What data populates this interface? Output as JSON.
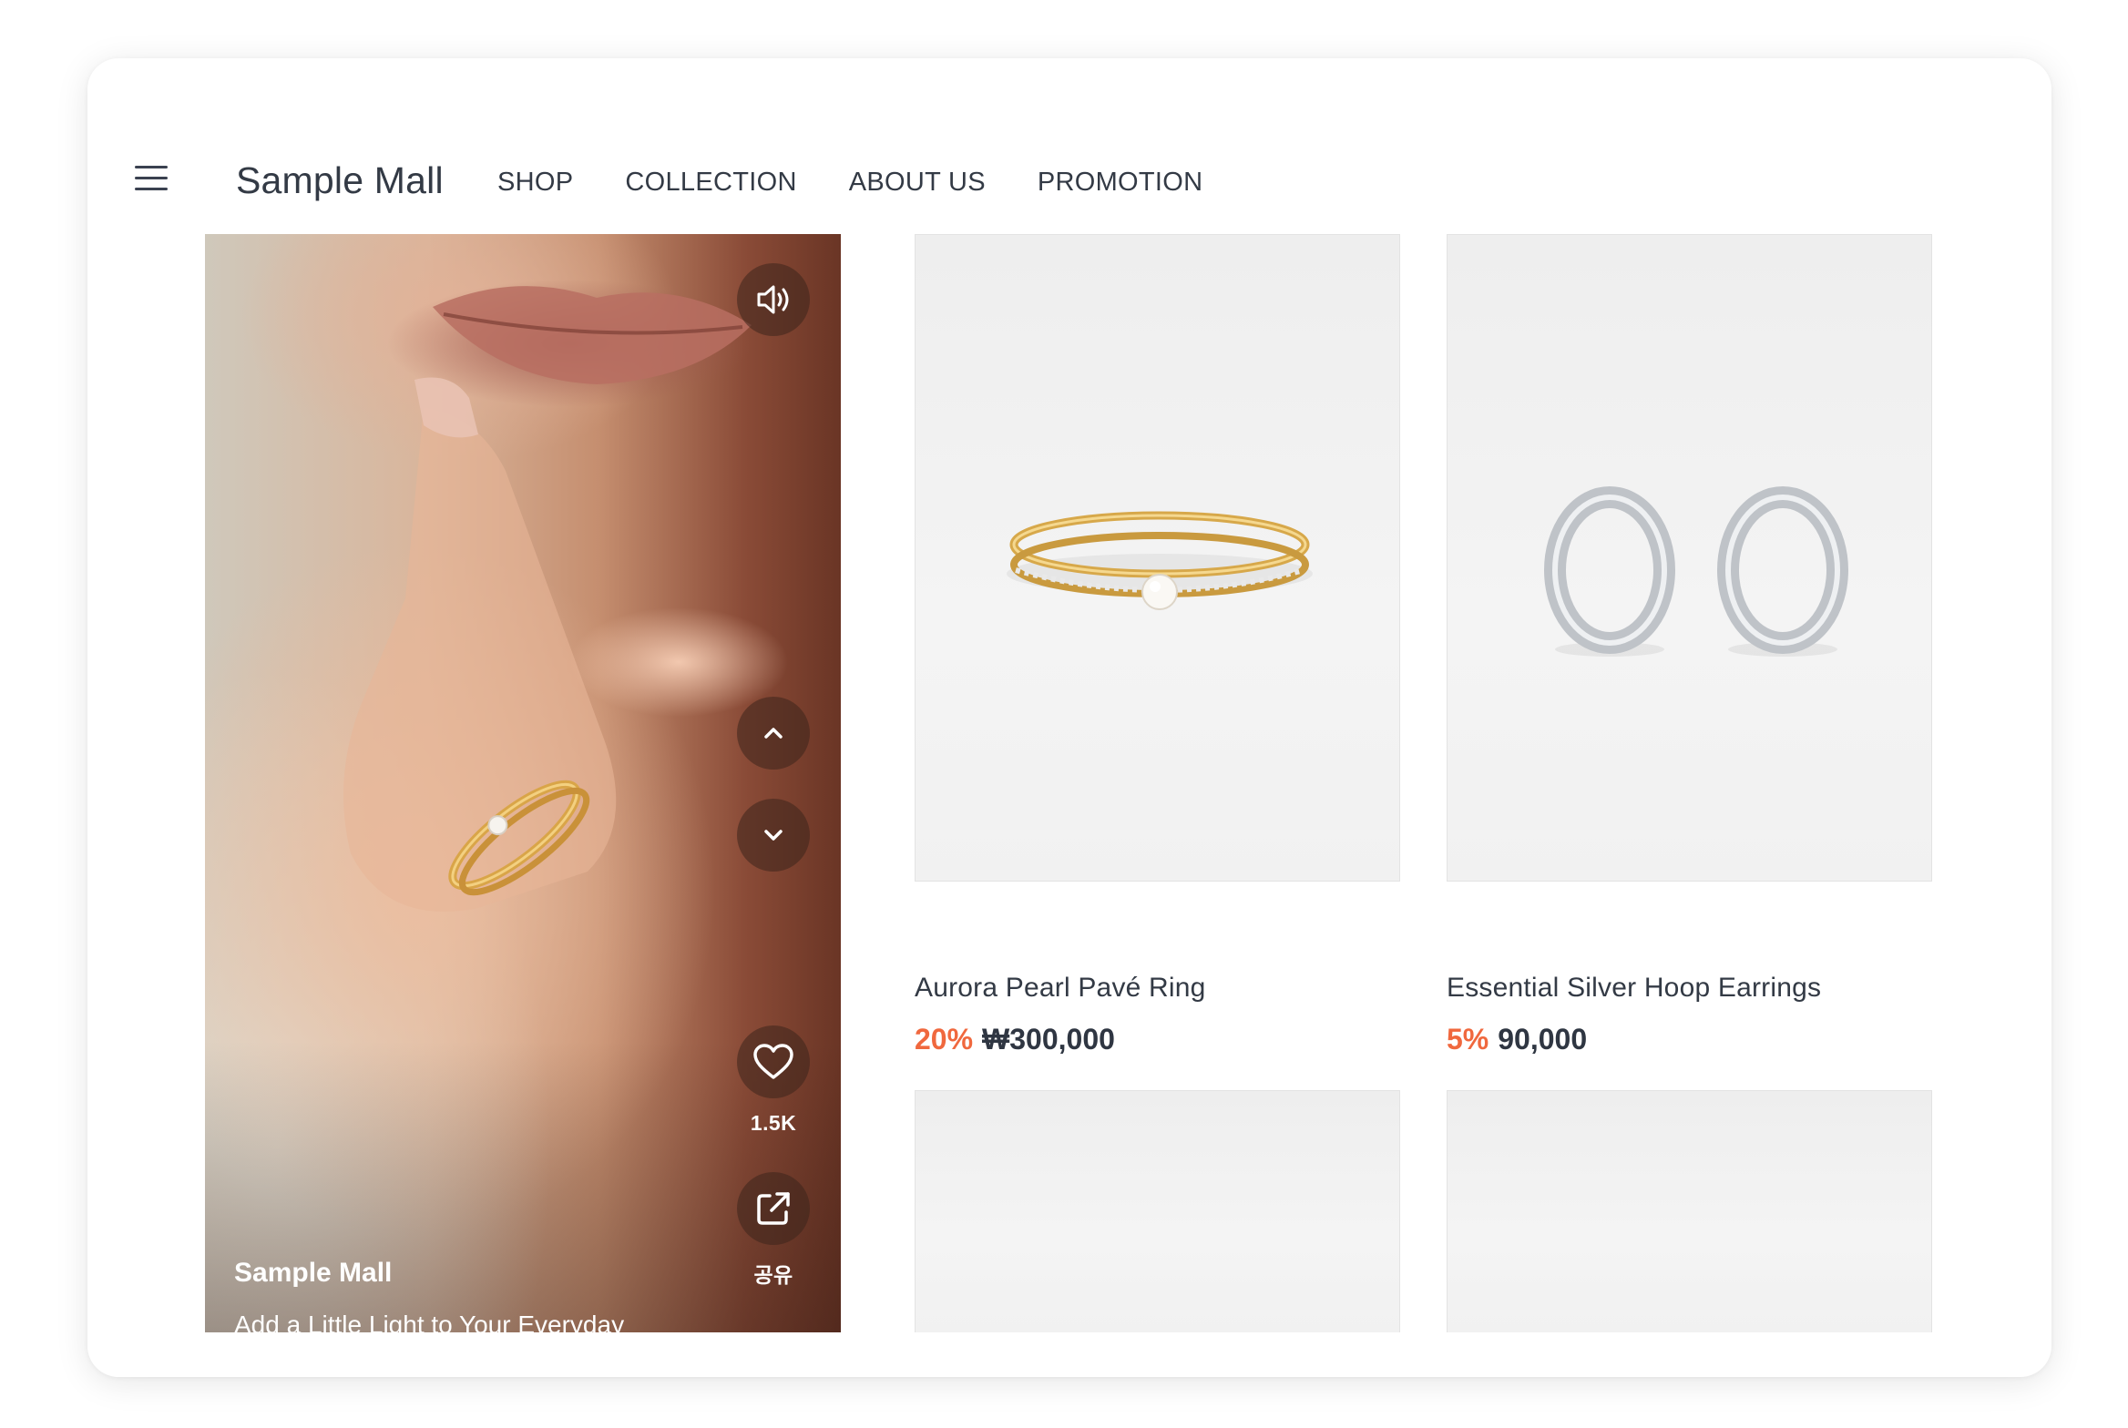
{
  "header": {
    "brand": "Sample Mall",
    "nav": [
      "SHOP",
      "COLLECTION",
      "ABOUT US",
      "PROMOTION"
    ]
  },
  "video": {
    "title": "Sample Mall",
    "subtitle": "Add a Little Light to Your Everyday",
    "likes": "1.5K",
    "share_label": "공유"
  },
  "products": [
    {
      "name": "Aurora Pearl Pavé Ring",
      "discount": "20%",
      "price": "₩300,000",
      "strikethrough": true
    },
    {
      "name": "Essential Silver Hoop Earrings",
      "discount": "5%",
      "price": "90,000",
      "strikethrough": false
    }
  ],
  "colors": {
    "accent": "#f0683e",
    "text": "#333a45",
    "card_bg": "#f2f2f2"
  },
  "icons": [
    "menu-icon",
    "sound-icon",
    "chevron-up-icon",
    "chevron-down-icon",
    "heart-icon",
    "share-icon"
  ]
}
